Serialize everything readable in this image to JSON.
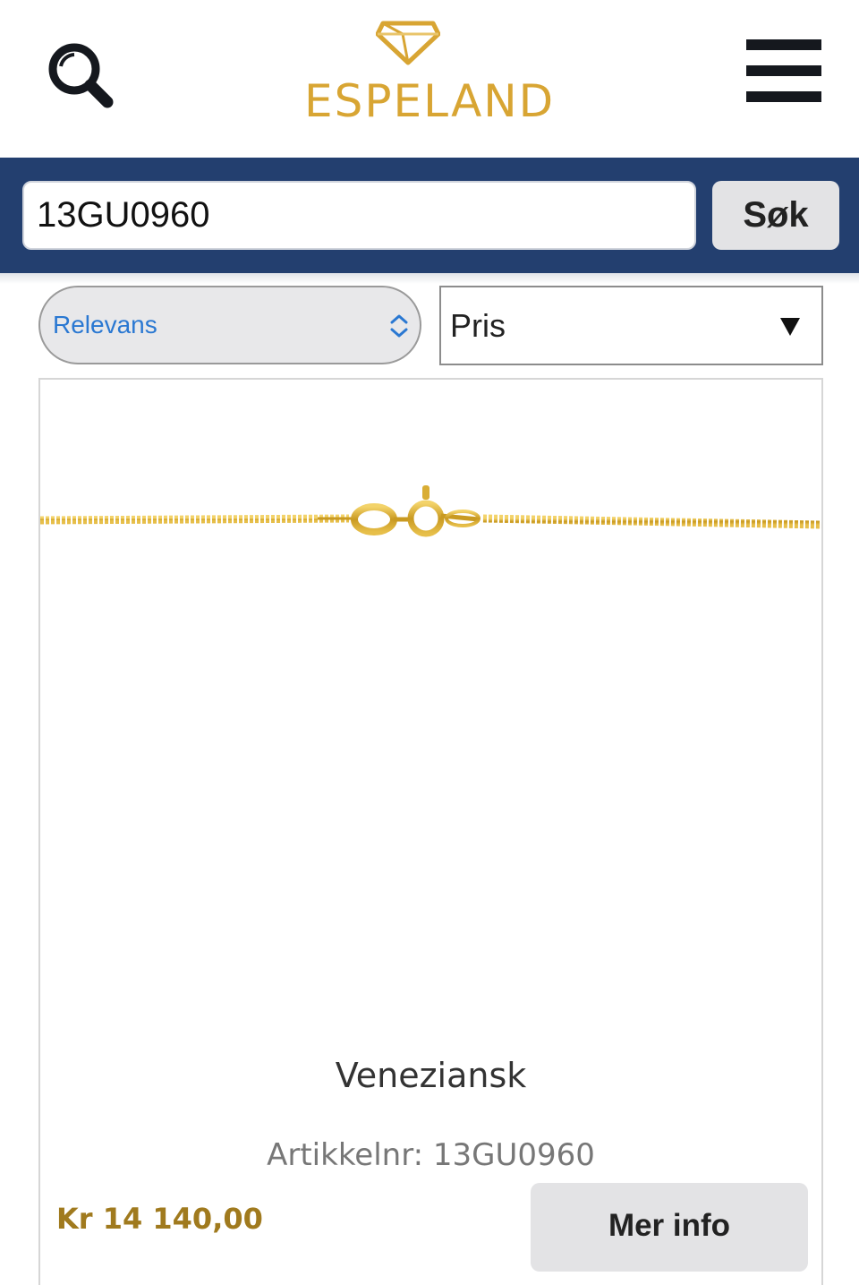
{
  "header": {
    "brand": "ESPELAND",
    "search_icon": "search-icon",
    "menu_icon": "hamburger-menu-icon"
  },
  "search": {
    "value": "13GU0960",
    "button_label": "Søk"
  },
  "sort": {
    "selected": "Relevans",
    "chevron_icon": "up-down-chevron-icon"
  },
  "price_filter": {
    "selected": "Pris",
    "arrow_icon": "triangle-down-icon"
  },
  "product": {
    "name": "Veneziansk",
    "sku_label": "Artikkelnr: 13GU0960",
    "price": "Kr 14 140,00",
    "more_info_label": "Mer info"
  },
  "colors": {
    "brand_gold": "#d8a533",
    "nav_blue": "#233f6f",
    "price_gold": "#a07a1e",
    "select_blue": "#2a78d2"
  }
}
